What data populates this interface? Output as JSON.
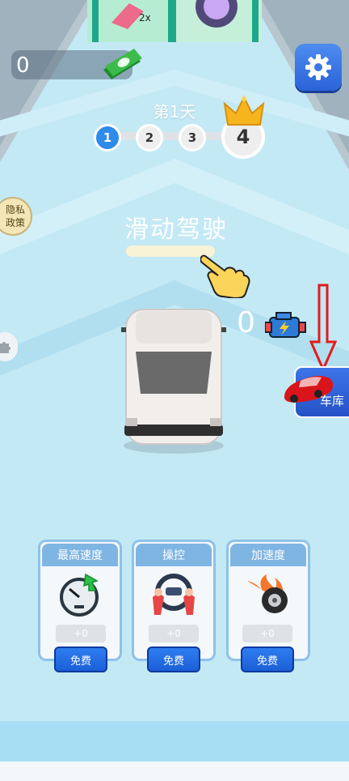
{
  "hud": {
    "money_value": "0",
    "day_label": "第1天",
    "steps": [
      "1",
      "2",
      "3",
      "4"
    ]
  },
  "side": {
    "privacy_label": "隐私\n政策"
  },
  "center": {
    "swipe_text": "滑动驾驶",
    "engine_count": "0"
  },
  "garage": {
    "label": "车库"
  },
  "upgrades": [
    {
      "title": "最高速度",
      "level": "+0",
      "button": "免费",
      "icon": "speedometer-icon"
    },
    {
      "title": "操控",
      "level": "+0",
      "button": "免费",
      "icon": "steering-wheel-icon"
    },
    {
      "title": "加速度",
      "level": "+0",
      "button": "免费",
      "icon": "flaming-tire-icon"
    }
  ],
  "colors": {
    "accent_blue": "#2e7df0",
    "card_header": "#7fb5e3",
    "road": "#bfe6f2",
    "arrow_red": "#e21b1b"
  }
}
